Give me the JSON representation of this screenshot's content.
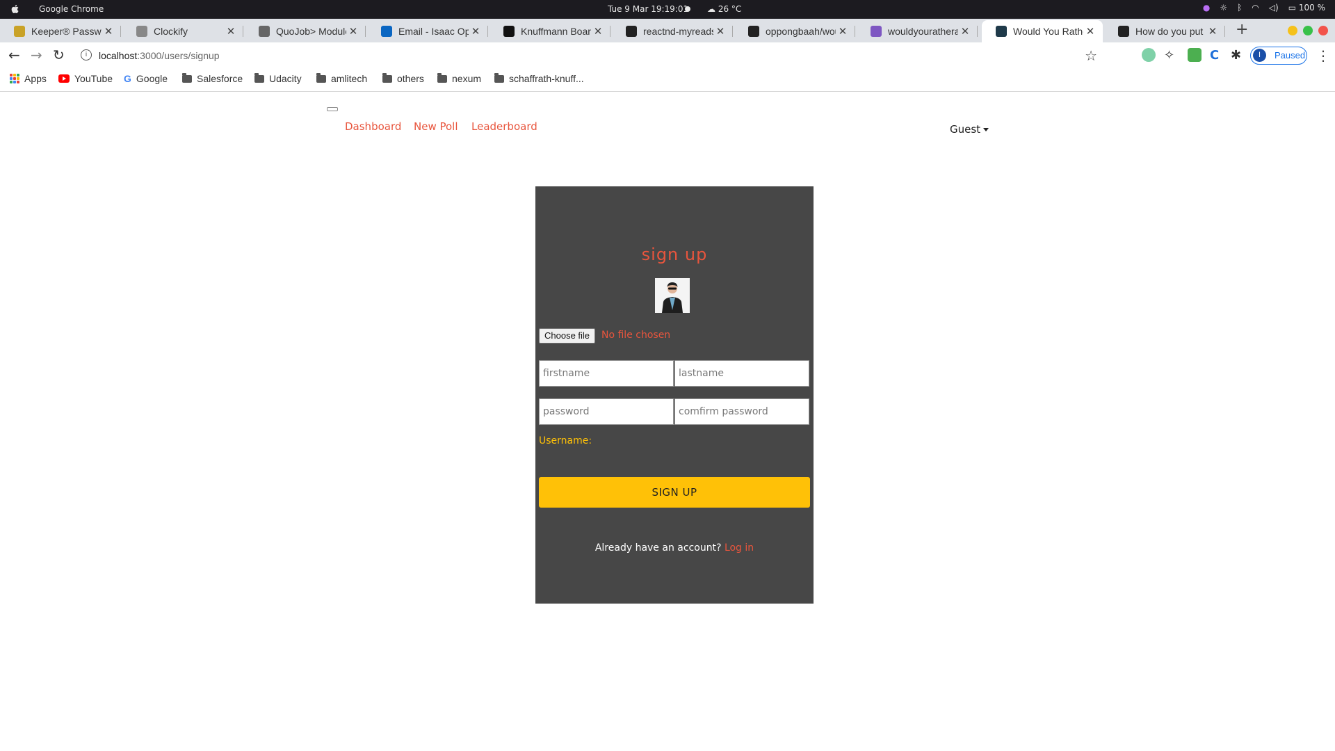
{
  "os": {
    "app_name": "Google Chrome",
    "clock": "Tue 9 Mar   19:19:01",
    "weather": "26 °C",
    "battery": "100 %"
  },
  "tabs": [
    {
      "title": "Keeper® Password",
      "fav_color": "#c9a227"
    },
    {
      "title": "Clockify",
      "fav_color": "#888888"
    },
    {
      "title": "QuoJob> Module",
      "fav_color": "#666666"
    },
    {
      "title": "Email - Isaac Opp",
      "fav_color": "#0a66c2"
    },
    {
      "title": "Knuffmann Board",
      "fav_color": "#111111"
    },
    {
      "title": "reactnd-myreads",
      "fav_color": "#222222"
    },
    {
      "title": "oppongbaah/wou",
      "fav_color": "#222222"
    },
    {
      "title": "wouldyourathera",
      "fav_color": "#7e57c2"
    },
    {
      "title": "Would You Rather",
      "fav_color": "#1f3a4a"
    },
    {
      "title": "How do you put In",
      "fav_color": "#222222"
    }
  ],
  "toolbar": {
    "url_host": "localhost",
    "url_path": ":3000/users/signup",
    "profile_initial": "I",
    "profile_status": "Paused"
  },
  "bookmarks": [
    {
      "label": "Apps",
      "icon": "apps-grid-icon"
    },
    {
      "label": "YouTube",
      "icon": "youtube-icon"
    },
    {
      "label": "Google",
      "icon": "google-icon"
    },
    {
      "label": "Salesforce",
      "icon": "folder-icon"
    },
    {
      "label": "Udacity",
      "icon": "folder-icon"
    },
    {
      "label": "amlitech",
      "icon": "folder-icon"
    },
    {
      "label": "others",
      "icon": "folder-icon"
    },
    {
      "label": "nexum",
      "icon": "folder-icon"
    },
    {
      "label": "schaffrath-knuff...",
      "icon": "folder-icon"
    }
  ],
  "nav": {
    "links": [
      "Dashboard",
      "New Poll",
      "Leaderboard"
    ],
    "user": "Guest"
  },
  "form": {
    "title": "sign up",
    "file_button": "Choose file",
    "file_status": "No file chosen",
    "firstname_placeholder": "firstname",
    "lastname_placeholder": "lastname",
    "password_placeholder": "password",
    "confirm_placeholder": "comfirm password",
    "username_label": "Username:",
    "submit_label": "SIGN UP",
    "already_text": "Already have an account?",
    "login_link": "Log in"
  },
  "colors": {
    "accent": "#e8553d",
    "button": "#ffc107",
    "card": "#474747"
  }
}
